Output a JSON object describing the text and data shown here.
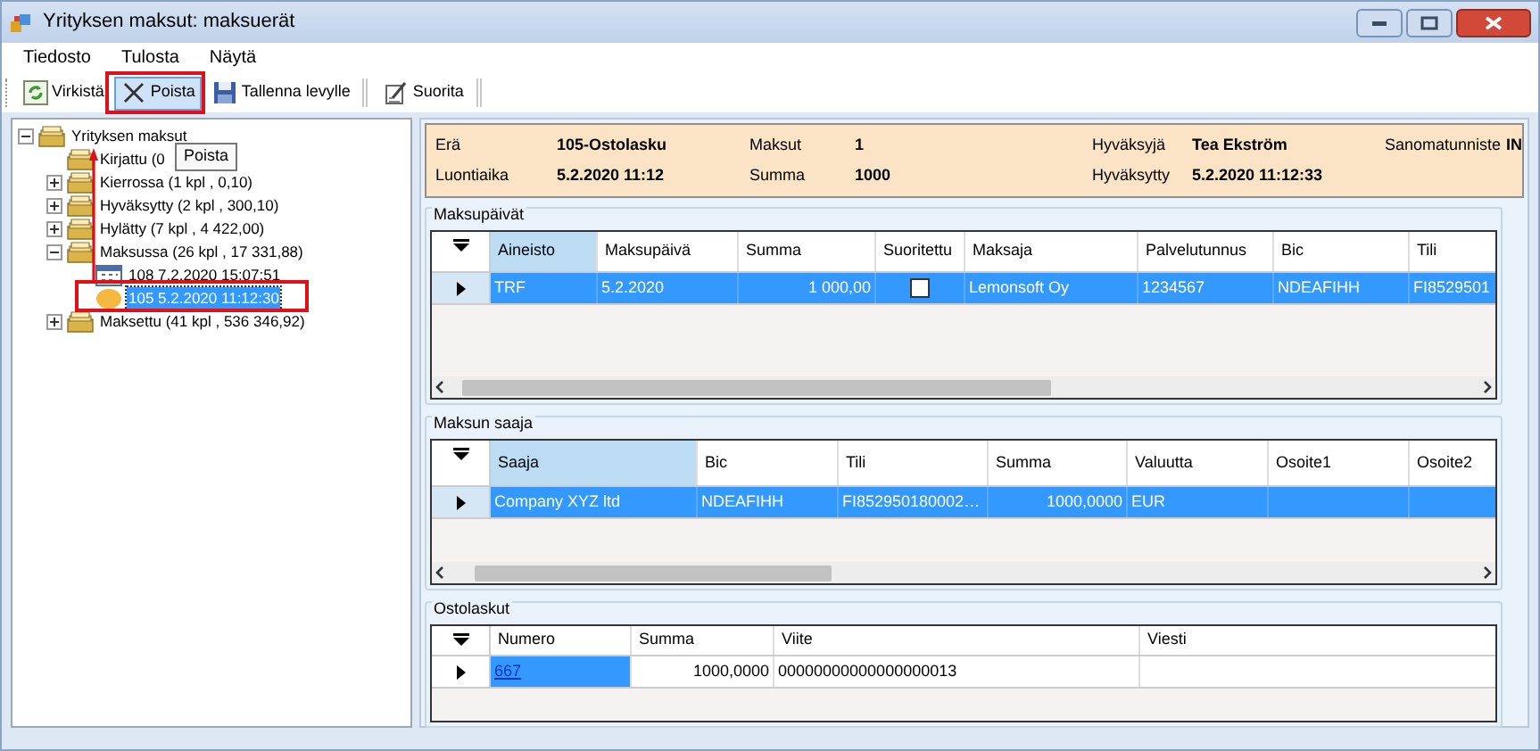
{
  "window": {
    "title": "Yrityksen maksut: maksuerät"
  },
  "menu": [
    "Tiedosto",
    "Tulosta",
    "Näytä"
  ],
  "toolbar": [
    {
      "label": "Virkistä",
      "kind": "refresh",
      "hovered": false,
      "separator_after": false
    },
    {
      "label": "Poista",
      "kind": "delete",
      "hovered": true,
      "separator_after": false
    },
    {
      "label": "Tallenna levylle",
      "kind": "save",
      "hovered": false,
      "separator_after": true
    },
    {
      "label": "Suorita",
      "kind": "execute",
      "hovered": false,
      "separator_after": true
    }
  ],
  "tree": [
    {
      "label": "Yrityksen maksut",
      "kind": "folder",
      "expanded": true,
      "selected": false,
      "children": [
        {
          "label": "Kirjattu (0",
          "kind": "folder",
          "selected": false
        },
        {
          "label": "Kierrossa (1 kpl , 0,10)",
          "kind": "folder",
          "expanded": false,
          "selected": false
        },
        {
          "label": "Hyväksytty (2 kpl , 300,10)",
          "kind": "folder",
          "expanded": false,
          "selected": false
        },
        {
          "label": "Hylätty (7 kpl , 4 422,00)",
          "kind": "folder",
          "expanded": false,
          "selected": false
        },
        {
          "label": "Maksussa (26 kpl , 17 331,88)",
          "kind": "folder",
          "expanded": true,
          "selected": false,
          "children": [
            {
              "label": "108 7.2.2020 15:07:51",
              "kind": "calendar",
              "selected": false
            },
            {
              "label": "105 5.2.2020 11:12:30",
              "kind": "circle",
              "selected": true
            }
          ]
        },
        {
          "label": "Maksettu (41 kpl , 536 346,92)",
          "kind": "folder",
          "expanded": false,
          "selected": false
        }
      ]
    }
  ],
  "tooltip": "Poista",
  "summary": [
    [
      {
        "label": "Erä",
        "value": "105-Ostolasku"
      },
      {
        "label": "Maksut",
        "value": "1"
      },
      {
        "label": "Hyväksyjä",
        "value": "Tea Ekström"
      },
      {
        "label": "Sanomatunniste",
        "value": "IN"
      }
    ],
    [
      {
        "label": "Luontiaika",
        "value": "5.2.2020 11:12"
      },
      {
        "label": "Summa",
        "value": "1000"
      },
      {
        "label": "Hyväksytty",
        "value": "5.2.2020 11:12:33"
      }
    ]
  ],
  "grids": [
    {
      "title": "Maksupäivät",
      "columns": [
        {
          "label": "Aineisto",
          "selected": true
        },
        {
          "label": "Maksupäivä",
          "selected": false
        },
        {
          "label": "Summa",
          "selected": false
        },
        {
          "label": "Suoritettu",
          "selected": false
        },
        {
          "label": "Maksaja",
          "selected": false
        },
        {
          "label": "Palvelutunnus",
          "selected": false
        },
        {
          "label": "Bic",
          "selected": false
        },
        {
          "label": "Tili",
          "selected": false
        }
      ],
      "rows": [
        {
          "selected": true,
          "cells": [
            "TRF",
            "5.2.2020",
            "1 000,00",
            {
              "kind": "checkbox",
              "checked": false
            },
            "Lemonsoft Oy",
            "1234567",
            "NDEAFIHH",
            "FI8529501"
          ]
        }
      ]
    },
    {
      "title": "Maksun saaja",
      "columns": [
        {
          "label": "Saaja",
          "selected": true
        },
        {
          "label": "Bic",
          "selected": false
        },
        {
          "label": "Tili",
          "selected": false
        },
        {
          "label": "Summa",
          "selected": false
        },
        {
          "label": "Valuutta",
          "selected": false
        },
        {
          "label": "Osoite1",
          "selected": false
        },
        {
          "label": "Osoite2",
          "selected": false
        }
      ],
      "rows": [
        {
          "selected": true,
          "cells": [
            "Company XYZ ltd",
            "NDEAFIHH",
            "FI852950180002…",
            "1000,0000",
            "EUR"
          ]
        }
      ]
    },
    {
      "title": "Ostolaskut",
      "columns": [
        {
          "label": "Numero",
          "selected": false
        },
        {
          "label": "Summa",
          "selected": false
        },
        {
          "label": "Viite",
          "selected": false
        },
        {
          "label": "Viesti",
          "selected": false
        }
      ],
      "rows": [
        {
          "selected": false,
          "cells": [
            {
              "text": "667",
              "link": true,
              "current": true
            },
            "1000,0000",
            "00000000000000000013"
          ]
        }
      ]
    }
  ]
}
